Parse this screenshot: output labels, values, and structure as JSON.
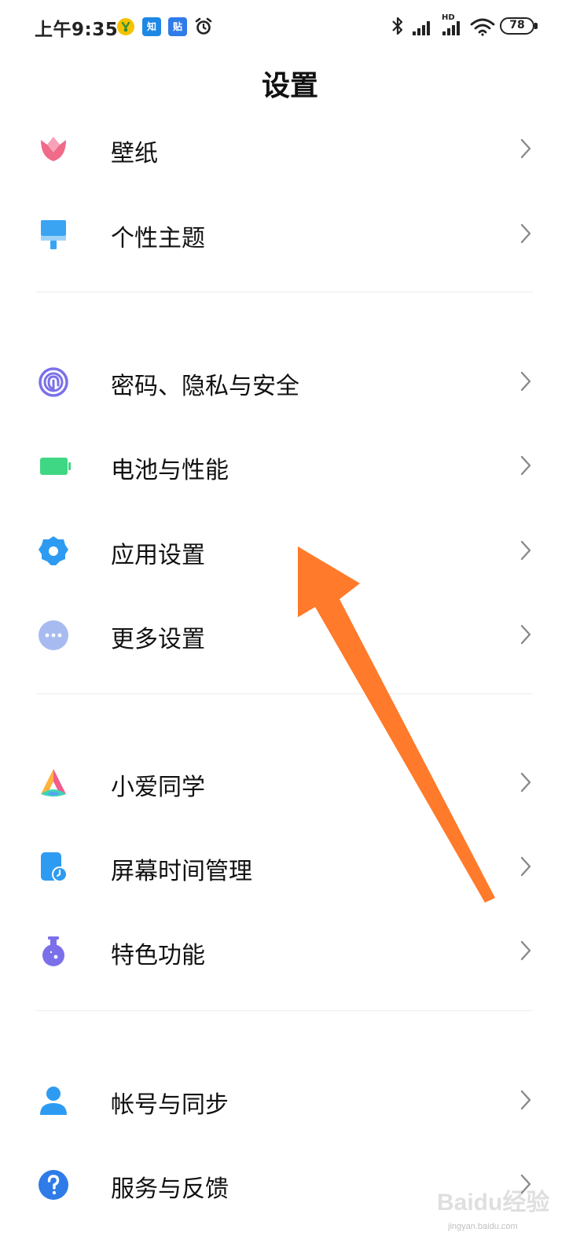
{
  "status_bar": {
    "time": "上午9:35",
    "app_icons": [
      {
        "name": "music-icon",
        "color": "#F5C200"
      },
      {
        "name": "zhihu-icon",
        "label": "知",
        "color": "#1E88E5"
      },
      {
        "name": "tieba-icon",
        "label": "贴",
        "color": "#2F7BE8"
      },
      {
        "name": "alarm-icon"
      }
    ],
    "hd_label": "HD",
    "battery_level": "78"
  },
  "header": {
    "title": "设置"
  },
  "settings_items": [
    {
      "label": "壁纸",
      "icon": "wallpaper-tulip-icon",
      "color": "#F06A8A"
    },
    {
      "label": "个性主题",
      "icon": "theme-brush-icon",
      "color": "#3AA4F2"
    },
    {
      "label": "密码、隐私与安全",
      "icon": "fingerprint-icon",
      "color": "#7B70EA"
    },
    {
      "label": "电池与性能",
      "icon": "battery-icon",
      "color": "#3FD784"
    },
    {
      "label": "应用设置",
      "icon": "gear-icon",
      "color": "#2E9BF2"
    },
    {
      "label": "更多设置",
      "icon": "more-dots-icon",
      "color": "#A8BBF0"
    },
    {
      "label": "小爱同学",
      "icon": "xiaoai-icon",
      "color": "#F25C8C"
    },
    {
      "label": "屏幕时间管理",
      "icon": "screen-time-icon",
      "color": "#2E9BF2"
    },
    {
      "label": "特色功能",
      "icon": "flask-icon",
      "color": "#7B70EA"
    },
    {
      "label": "帐号与同步",
      "icon": "account-icon",
      "color": "#2E9BF2"
    },
    {
      "label": "服务与反馈",
      "icon": "help-icon",
      "color": "#2F7BE8"
    }
  ],
  "annotation": {
    "arrow_color": "#FF7A2A"
  },
  "watermark": {
    "text": "Baidu经验",
    "sub": "jingyan.baidu.com"
  }
}
